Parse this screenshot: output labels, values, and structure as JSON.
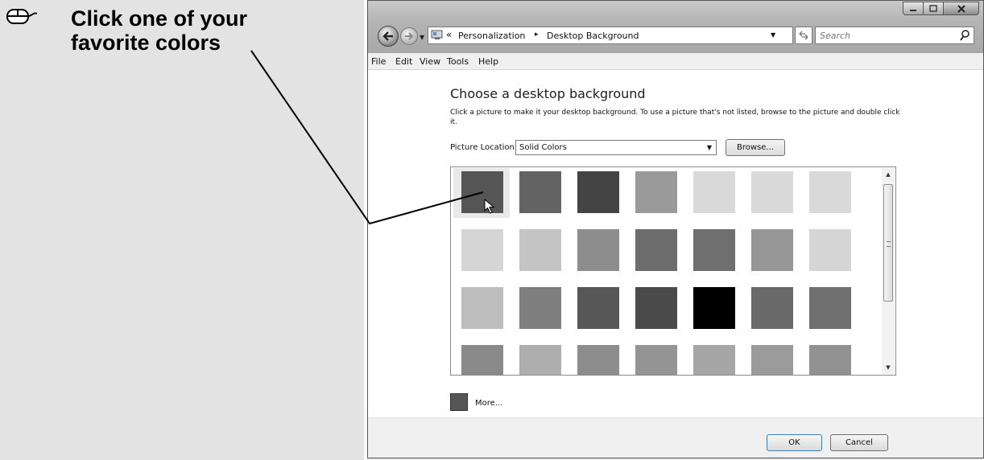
{
  "instruction": {
    "line1": "Click one of your",
    "line2": "favorite colors",
    "icon": "mouse-click-icon"
  },
  "window": {
    "controls": [
      "minimize-icon",
      "maximize-icon",
      "close-icon"
    ],
    "address": {
      "crumbs": [
        "Personalization",
        "Desktop Background"
      ],
      "chevron": "«",
      "separator": "▸"
    },
    "search_placeholder": "Search",
    "menu": [
      "File",
      "Edit",
      "View",
      "Tools",
      "Help"
    ]
  },
  "main": {
    "title": "Choose a desktop background",
    "description": "Click a picture to make it your desktop background. To use a picture that's not listed, browse to the picture and double click it.",
    "location_label": "Picture Location",
    "location_value": "Solid Colors",
    "browse_label": "Browse...",
    "swatch_colors": [
      [
        "#555555",
        "#636363",
        "#444444",
        "#9a9a9a",
        "#d9d9d9",
        "#dadada",
        "#d9d9d9"
      ],
      [
        "#d5d5d5",
        "#c4c4c4",
        "#8d8d8d",
        "#6c6c6c",
        "#6f6f6f",
        "#969696",
        "#d5d5d5"
      ],
      [
        "#bdbdbd",
        "#7f7f7f",
        "#575757",
        "#4b4b4b",
        "#000000",
        "#6a6a6a",
        "#707070"
      ],
      [
        "#8a8a8a",
        "#aeaeae",
        "#8d8d8d",
        "#949494",
        "#a6a6a6",
        "#9b9b9b",
        "#929292"
      ]
    ],
    "selected_swatch": "row 1, column 1",
    "more_label": "More...",
    "more_color": "#555555"
  },
  "footer": {
    "ok_label": "OK",
    "cancel_label": "Cancel"
  }
}
